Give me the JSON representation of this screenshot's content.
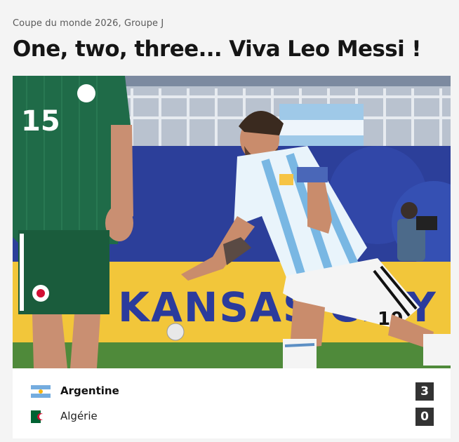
{
  "article": {
    "kicker": "Coupe du monde 2026, Groupe J",
    "headline": "One, two, three... Viva Leo Messi !"
  },
  "photo": {
    "description_visible_text": {
      "jersey_number_left": "15",
      "jersey_number_right": "10",
      "advertising_board": "KANSAS CITY"
    },
    "colors": {
      "pitch_wall": "#2c3f9a",
      "board_yellow": "#f2c63a",
      "board_text": "#2b3b9c",
      "grass": "#4f8a3a",
      "algeria_kit": "#1f6b48",
      "argentina_light": "#bfe0f3"
    }
  },
  "match": {
    "teams": [
      {
        "name": "Argentine",
        "score": "3",
        "flag": "argentina-flag-icon",
        "winner": true
      },
      {
        "name": "Algérie",
        "score": "0",
        "flag": "algeria-flag-icon",
        "winner": false
      }
    ]
  }
}
